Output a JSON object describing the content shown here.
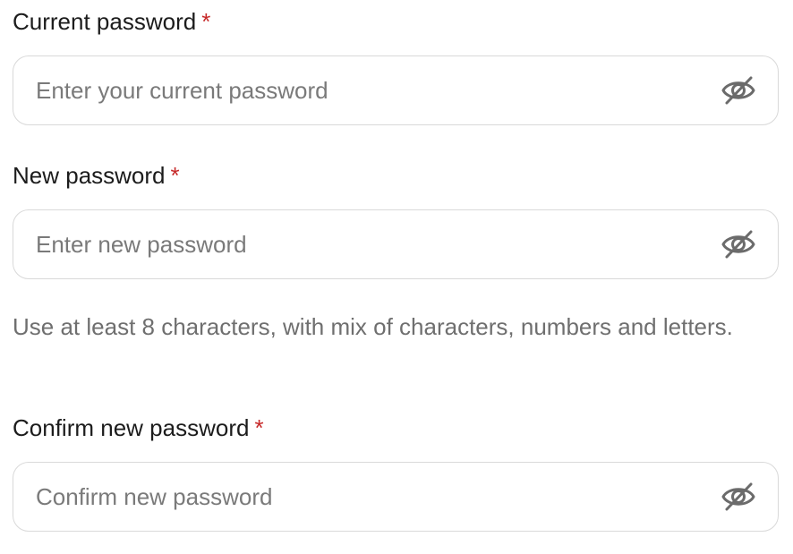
{
  "form": {
    "current": {
      "label": "Current password",
      "required_mark": "*",
      "placeholder": "Enter your current password",
      "value": "",
      "toggle_icon": "eye-off-icon"
    },
    "new": {
      "label": "New password",
      "required_mark": "*",
      "placeholder": "Enter new password",
      "value": "",
      "toggle_icon": "eye-off-icon"
    },
    "helper": "Use at least 8 characters, with mix of characters, numbers and letters.",
    "confirm": {
      "label": "Confirm new password",
      "required_mark": "*",
      "placeholder": "Confirm new password",
      "value": "",
      "toggle_icon": "eye-off-icon"
    }
  },
  "colors": {
    "required": "#c62828",
    "border": "#d9d9d9",
    "placeholder": "#7a7a7a",
    "helper": "#6f6f6f"
  }
}
